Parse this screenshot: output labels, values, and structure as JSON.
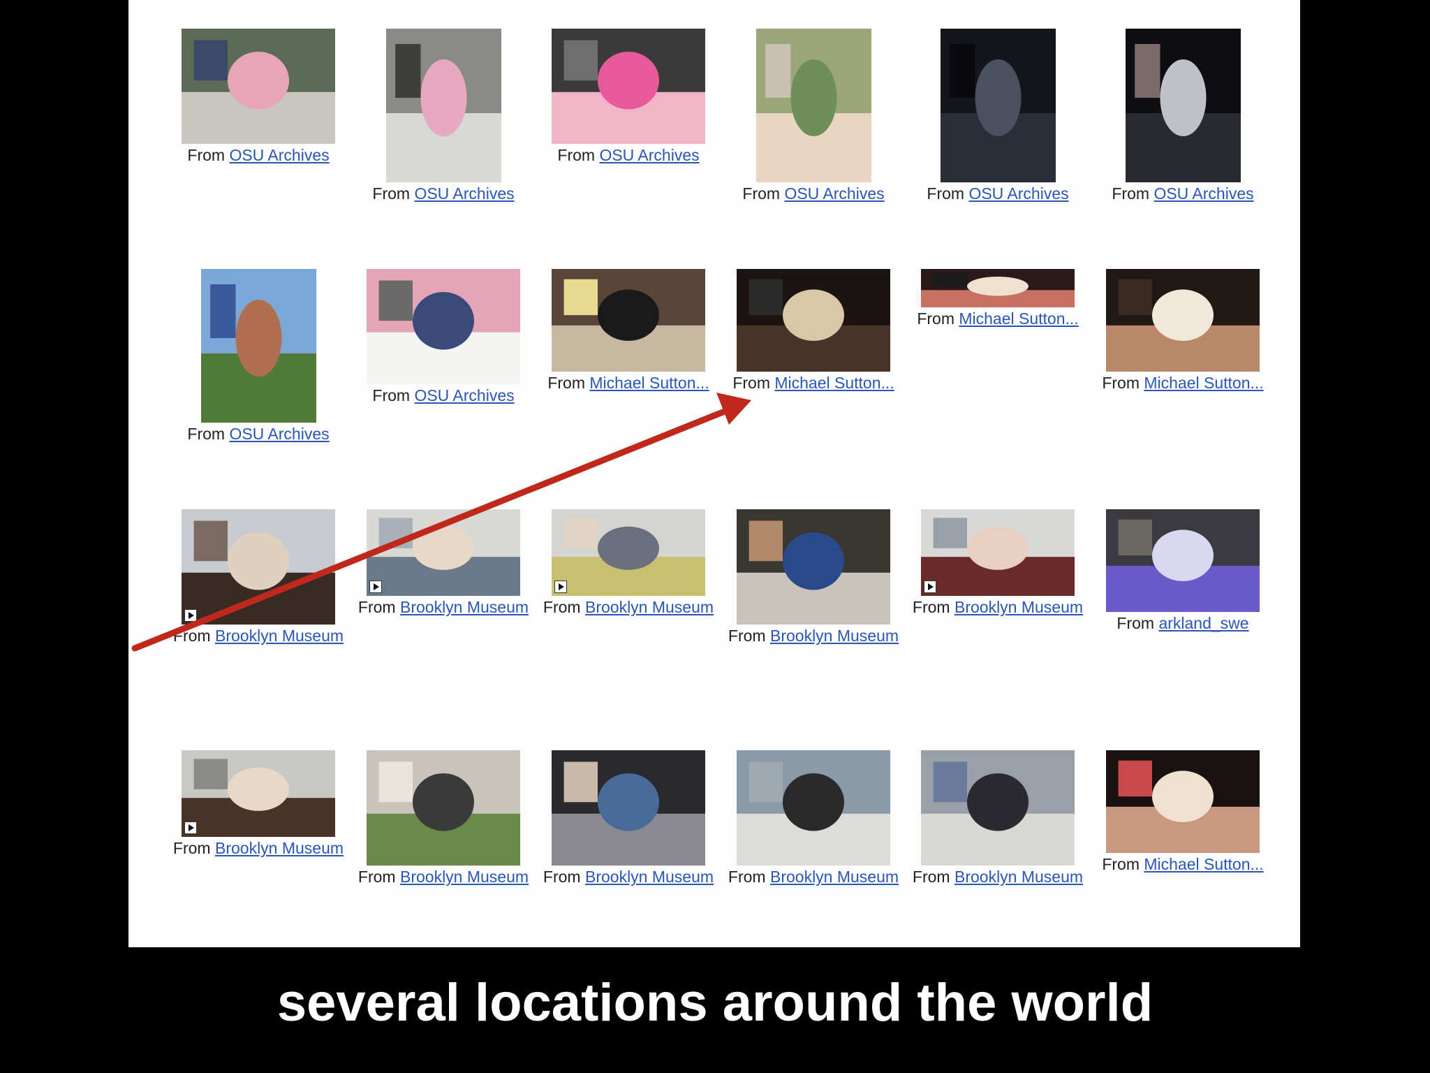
{
  "caption_prefix": "From",
  "slide_caption": "several locations around the world",
  "colors": {
    "link": "#2a56b8",
    "arrow": "#c0281c",
    "panel": "#fdfdfd",
    "background": "#000000"
  },
  "icons": {
    "video": "play-icon",
    "arrow": "red-arrow"
  },
  "rows": [
    [
      {
        "source": "OSU Archives",
        "video": false,
        "w": 220,
        "h": 165,
        "palette": [
          "#5d6b56",
          "#c9c5c0",
          "#e6a6b8",
          "#3b4a68"
        ]
      },
      {
        "source": "OSU Archives",
        "video": false,
        "w": 165,
        "h": 220,
        "palette": [
          "#8a8a86",
          "#d8d8d4",
          "#e8a8c0",
          "#3e3e3a"
        ]
      },
      {
        "source": "OSU Archives",
        "video": false,
        "w": 220,
        "h": 165,
        "palette": [
          "#3a3a3a",
          "#f0b6c8",
          "#e85a9c",
          "#6e6e6e"
        ]
      },
      {
        "source": "OSU Archives",
        "video": false,
        "w": 165,
        "h": 220,
        "palette": [
          "#9aa57a",
          "#e8d6c0",
          "#6f8f5a",
          "#c8c0b0"
        ]
      },
      {
        "source": "OSU Archives",
        "video": false,
        "w": 165,
        "h": 220,
        "palette": [
          "#14161c",
          "#2a2e38",
          "#4a5060",
          "#0a0a0e"
        ]
      },
      {
        "source": "OSU Archives",
        "video": false,
        "w": 165,
        "h": 220,
        "palette": [
          "#0e0e12",
          "#2a2a32",
          "#c0c0c8",
          "#7a6a6a"
        ]
      }
    ],
    [
      {
        "source": "OSU Archives",
        "video": false,
        "w": 165,
        "h": 220,
        "palette": [
          "#7aa8d8",
          "#4f7a38",
          "#b07050",
          "#3a5a9c"
        ]
      },
      {
        "source": "OSU Archives",
        "video": false,
        "w": 220,
        "h": 165,
        "palette": [
          "#e4a6b6",
          "#f4f4f2",
          "#3a4a7a",
          "#6a6a6a"
        ]
      },
      {
        "source": "Michael Sutton...",
        "video": false,
        "w": 220,
        "h": 147,
        "palette": [
          "#5a4638",
          "#c8b8a0",
          "#1a1a1a",
          "#e8d890"
        ]
      },
      {
        "source": "Michael Sutton...",
        "video": false,
        "w": 220,
        "h": 147,
        "palette": [
          "#1a1412",
          "#4a3428",
          "#d8c8a8",
          "#2a2a2a"
        ]
      },
      {
        "source": "Michael Sutton...",
        "video": false,
        "w": 220,
        "h": 55,
        "palette": [
          "#2a1a1a",
          "#c87060",
          "#f0e0d0",
          "#1a1a1a"
        ]
      },
      {
        "source": "Michael Sutton...",
        "video": false,
        "w": 220,
        "h": 147,
        "palette": [
          "#201814",
          "#b88868",
          "#f0e8d8",
          "#3a2a22"
        ]
      }
    ],
    [
      {
        "source": "Brooklyn Museum",
        "video": true,
        "w": 220,
        "h": 165,
        "palette": [
          "#c8ccd0",
          "#3a2a24",
          "#e0d0c0",
          "#7a6a60"
        ]
      },
      {
        "source": "Brooklyn Museum",
        "video": true,
        "w": 220,
        "h": 124,
        "palette": [
          "#d8d8d4",
          "#6a7a8a",
          "#e8d8c8",
          "#aab0b8"
        ]
      },
      {
        "source": "Brooklyn Museum",
        "video": true,
        "w": 220,
        "h": 124,
        "palette": [
          "#d4d4d0",
          "#c8c070",
          "#6a7080",
          "#e0d4c4"
        ]
      },
      {
        "source": "Brooklyn Museum",
        "video": false,
        "w": 220,
        "h": 165,
        "palette": [
          "#3a3630",
          "#c8c4bc",
          "#2a4a8a",
          "#b08a6a"
        ]
      },
      {
        "source": "Brooklyn Museum",
        "video": true,
        "w": 220,
        "h": 124,
        "palette": [
          "#d8d8d6",
          "#6a2a2a",
          "#e8d0c0",
          "#9aa0a8"
        ]
      },
      {
        "source": "arkland_swe",
        "video": false,
        "w": 220,
        "h": 147,
        "palette": [
          "#3a3a40",
          "#6a5ac8",
          "#d8d8f0",
          "#6a6660"
        ]
      }
    ],
    [
      {
        "source": "Brooklyn Museum",
        "video": true,
        "w": 220,
        "h": 124,
        "palette": [
          "#c8c8c4",
          "#4a3428",
          "#e8d8c8",
          "#8a8a88"
        ]
      },
      {
        "source": "Brooklyn Museum",
        "video": false,
        "w": 220,
        "h": 165,
        "palette": [
          "#c8c4bc",
          "#6a8a4a",
          "#3a3a3a",
          "#e8e4dc"
        ]
      },
      {
        "source": "Brooklyn Museum",
        "video": false,
        "w": 220,
        "h": 165,
        "palette": [
          "#2a2a2e",
          "#8a8a90",
          "#4a6a9a",
          "#c8b8a8"
        ]
      },
      {
        "source": "Brooklyn Museum",
        "video": false,
        "w": 220,
        "h": 165,
        "palette": [
          "#8a9aa8",
          "#dcdcd8",
          "#2a2a2a",
          "#a0a8b0"
        ]
      },
      {
        "source": "Brooklyn Museum",
        "video": false,
        "w": 220,
        "h": 165,
        "palette": [
          "#9aa0a8",
          "#d8d8d4",
          "#2a2a30",
          "#6a7a9a"
        ]
      },
      {
        "source": "Michael Sutton...",
        "video": false,
        "w": 220,
        "h": 147,
        "palette": [
          "#1a1210",
          "#c89880",
          "#f0e0d0",
          "#c84a4a"
        ]
      }
    ]
  ]
}
